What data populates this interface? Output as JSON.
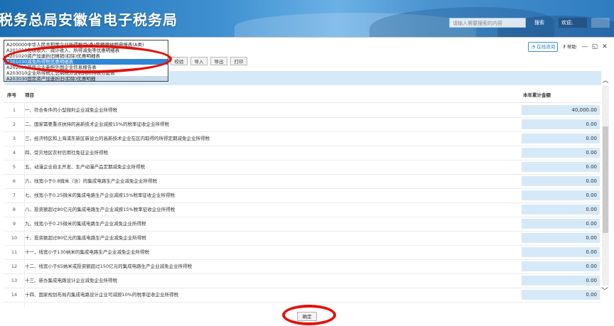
{
  "header": {
    "site_title": "税务总局安徽省电子税务局",
    "search_placeholder": "请输入需要搜索的内容",
    "search_label": "搜索",
    "welcome_label": "欢迎,"
  },
  "dropdown": {
    "items": [
      {
        "label": "A200000中华人民共和国企业所得税月(季)度预缴纳税申报表(A类)",
        "state": "normal"
      },
      {
        "label": "A201010免税收入、减计收入、所得减免等优惠明细表",
        "state": "normal"
      },
      {
        "label": "A201020资产加速折旧摊销(扣除)优惠明细表",
        "state": "normal"
      },
      {
        "label": "A201030减免所得税优惠明细表",
        "state": "selected"
      },
      {
        "label": "A202000居民企业参照外国企业信息报告表",
        "state": "normal"
      },
      {
        "label": "A203010企业所得税汇总纳税分支机构所得税分配表",
        "state": "normal"
      },
      {
        "label": "A203030固定资产加速折旧(扣除)优惠明细",
        "state": "hover"
      }
    ]
  },
  "toolbar": {
    "buttons": [
      "校验",
      "导入",
      "导出",
      "打印"
    ],
    "online_label": "在线咨询",
    "help_label": "帮助"
  },
  "table": {
    "col_no": "序号",
    "col_name": "项目",
    "col_amount": "本年累计金额",
    "rows": [
      {
        "no": "1",
        "name": "一、符合条件的小型微利企业减免企业所得税",
        "amount": "40,000.00"
      },
      {
        "no": "2",
        "name": "二、国家需要重点扶持的高新技术企业减按15%的税率征收企业所得税",
        "amount": "0.00"
      },
      {
        "no": "3",
        "name": "三、经济特区和上海浦东新区新设立的高新技术企业在区内取得的所得定期减免企业所得税",
        "amount": "0.00"
      },
      {
        "no": "4",
        "name": "四、受灾地区农村信用社免征企业所得税",
        "amount": "0.00"
      },
      {
        "no": "5",
        "name": "五、动漫企业自主开发、生产动漫产品定期减免企业所得税",
        "amount": "0.00"
      },
      {
        "no": "6",
        "name": "六、线宽小于0.8微米（含）的集成电路生产企业减免企业所得税",
        "amount": "0.00"
      },
      {
        "no": "7",
        "name": "七、线宽小于0.25微米的集成电路生产企业减按15%税率征收企业所得税",
        "amount": "0.00"
      },
      {
        "no": "8",
        "name": "八、投资额超过80亿元的集成电路生产企业减按15%税率征收企业所得税",
        "amount": "0.00"
      },
      {
        "no": "9",
        "name": "九、线宽小于0.25微米的集成电路生产企业减免企业所得税",
        "amount": "0.00"
      },
      {
        "no": "10",
        "name": "十、投资额超过80亿元的集成电路生产企业减免企业所得税",
        "amount": "0.00"
      },
      {
        "no": "11",
        "name": "十一、线宽小于130纳米的集成电路生产企业减免企业所得税",
        "amount": "0.00"
      },
      {
        "no": "12",
        "name": "十二、线宽小于65纳米或投资额超过150亿元的集成电路生产企业减免企业所得税",
        "amount": "0.00"
      },
      {
        "no": "13",
        "name": "十三、新办集成电路设计企业减免企业所得税",
        "amount": "0.00"
      },
      {
        "no": "14",
        "name": "十四、国家规划布局内集成电路设计企业可减按10%的税率征收企业所得税",
        "amount": "0.00"
      }
    ]
  },
  "footer": {
    "confirm_label": "确定"
  },
  "colors": {
    "header_blue": "#2f7cc0",
    "selected_blue": "#2f86d6",
    "amount_bg": "#d6e9f8",
    "annotation_red": "#e4110b"
  }
}
